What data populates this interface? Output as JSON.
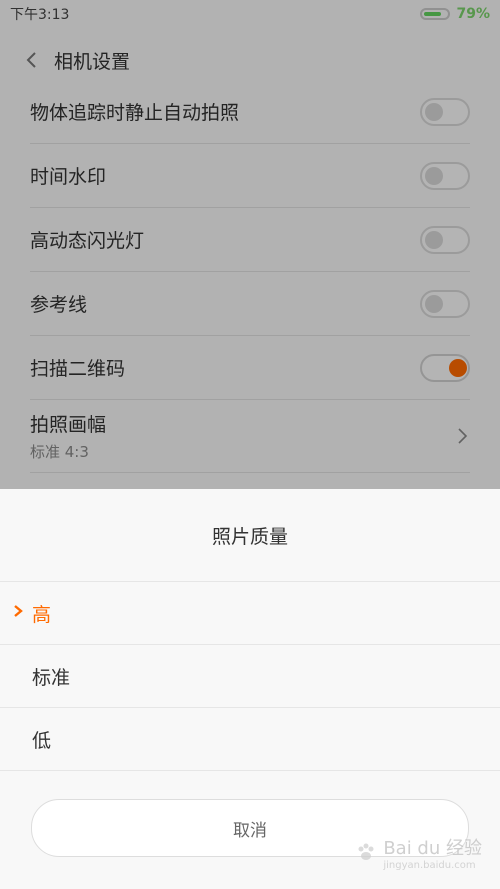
{
  "status_bar": {
    "time": "下午3:13",
    "battery_percent_text": "79%",
    "battery_level": 0.79
  },
  "header": {
    "title": "相机设置"
  },
  "settings": {
    "items": [
      {
        "label": "物体追踪时静止自动拍照",
        "enabled": false
      },
      {
        "label": "时间水印",
        "enabled": false
      },
      {
        "label": "高动态闪光灯",
        "enabled": false
      },
      {
        "label": "参考线",
        "enabled": false
      },
      {
        "label": "扫描二维码",
        "enabled": true
      }
    ],
    "aspect_item": {
      "label": "拍照画幅",
      "value": "标准 4:3"
    }
  },
  "sheet": {
    "title": "照片质量",
    "options": [
      {
        "label": "高",
        "selected": true
      },
      {
        "label": "标准",
        "selected": false
      },
      {
        "label": "低",
        "selected": false
      }
    ],
    "cancel_label": "取消"
  },
  "watermark": {
    "brand": "Bai du 经验",
    "url": "jingyan.baidu.com"
  },
  "colors": {
    "accent": "#ff6a00",
    "battery_green": "#62d15d"
  }
}
